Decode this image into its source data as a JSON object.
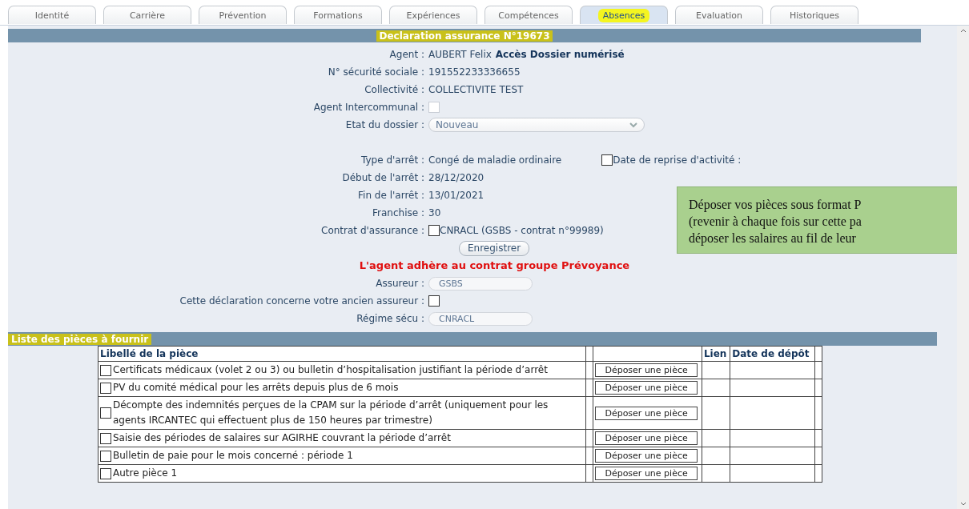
{
  "tabs": [
    {
      "label": "Identité",
      "selected": false
    },
    {
      "label": "Carrière",
      "selected": false
    },
    {
      "label": "Prévention",
      "selected": false
    },
    {
      "label": "Formations",
      "selected": false
    },
    {
      "label": "Expériences",
      "selected": false
    },
    {
      "label": "Compétences",
      "selected": false
    },
    {
      "label": "Absences",
      "selected": true,
      "highlighted": true
    },
    {
      "label": "Evaluation",
      "selected": false
    },
    {
      "label": "Historiques",
      "selected": false
    }
  ],
  "title": {
    "text": "Declaration assurance N°19673",
    "highlighted": true
  },
  "fields": [
    {
      "kind": "text",
      "label": "Agent :",
      "value": "AUBERT Felix",
      "link": "Accès Dossier numérisé"
    },
    {
      "kind": "text",
      "label": "N° sécurité sociale :",
      "value": "191552233336655"
    },
    {
      "kind": "text",
      "label": "Collectivité :",
      "value": "COLLECTIVITE TEST"
    },
    {
      "kind": "checkbox",
      "label": "Agent Intercommunal :",
      "checked": false
    },
    {
      "kind": "select",
      "label": "Etat du dossier :",
      "value": "Nouveau"
    },
    {
      "kind": "spacer"
    },
    {
      "kind": "text",
      "label": "Type d'arrêt :",
      "value": "Congé de maladie ordinaire",
      "extra_checkbox": {
        "label": "Date de reprise d'activité :",
        "checked": false
      }
    },
    {
      "kind": "text",
      "label": "Début de l'arrêt :",
      "value": "28/12/2020"
    },
    {
      "kind": "text",
      "label": "Fin de l'arrêt :",
      "value": "13/01/2021"
    },
    {
      "kind": "text",
      "label": "Franchise :",
      "value": "30"
    },
    {
      "kind": "checkbox",
      "label": "Contrat d'assurance :",
      "checked": false,
      "value": "CNRACL (GSBS - contrat n°99989)"
    },
    {
      "kind": "button",
      "label": "Enregistrer"
    },
    {
      "kind": "alert",
      "label": "L'agent adhère au contrat groupe Prévoyance"
    },
    {
      "kind": "input",
      "label": "Assureur :",
      "value": "GSBS"
    },
    {
      "kind": "checkbox",
      "label": "Cette déclaration concerne votre ancien assureur :",
      "checked": false
    },
    {
      "kind": "input",
      "label": "Régime sécu :",
      "value": "CNRACL"
    }
  ],
  "note": {
    "lines": [
      "Déposer vos pièces sous format P",
      "(revenir à chaque fois sur cette pa",
      "déposer les salaires au fil de leur"
    ]
  },
  "pieces": {
    "header": {
      "text": "Liste des pièces à fournir",
      "highlighted": true
    },
    "columns": [
      "Libellé de la pièce",
      "Lien",
      "Date de dépôt"
    ],
    "rows": [
      {
        "label": "Certificats médicaux (volet 2 ou 3) ou bulletin d’hospitalisation justifiant la période d’arrêt",
        "checked": false,
        "button": "Déposer une pièce"
      },
      {
        "label": "PV du comité médical pour les arrêts depuis plus de 6 mois",
        "checked": false,
        "button": "Déposer une pièce"
      },
      {
        "label": "Décompte des indemnités perçues de la CPAM sur la période d’arrêt (uniquement pour les agents IRCANTEC qui effectuent plus de 150 heures par trimestre)",
        "checked": false,
        "button": "Déposer une pièce"
      },
      {
        "label": "Saisie des périodes de salaires sur AGIRHE couvrant la période d’arrêt",
        "checked": false,
        "button": "Déposer une pièce"
      },
      {
        "label": "Bulletin de paie pour le mois concerné : période 1",
        "checked": false,
        "button": "Déposer une pièce"
      },
      {
        "label": "Autre pièce 1",
        "checked": false,
        "button": "Déposer une pièce"
      }
    ]
  }
}
